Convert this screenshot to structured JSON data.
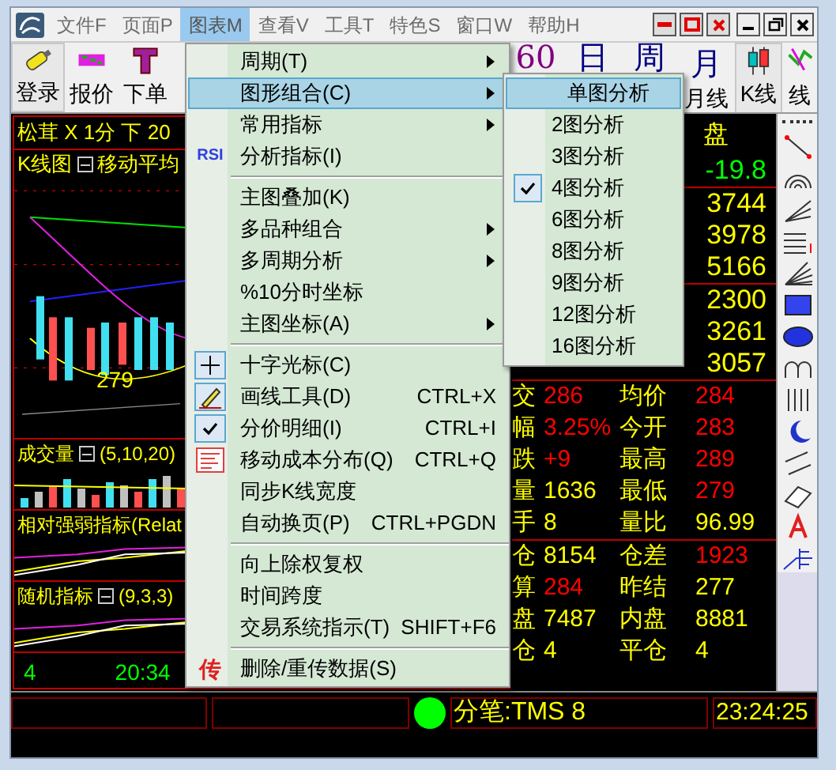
{
  "menu_bar": [
    {
      "label": "文件F",
      "selected": false
    },
    {
      "label": "页面P",
      "selected": false
    },
    {
      "label": "图表M",
      "selected": true
    },
    {
      "label": "查看V",
      "selected": false
    },
    {
      "label": "工具T",
      "selected": false
    },
    {
      "label": "特色S",
      "selected": false
    },
    {
      "label": "窗口W",
      "selected": false
    },
    {
      "label": "帮助H",
      "selected": false
    }
  ],
  "toolbar_left": [
    {
      "label": "登录"
    },
    {
      "label": "报价"
    },
    {
      "label": "下单"
    }
  ],
  "toolbar_right": [
    {
      "glyph": "60",
      "color": "#800080"
    },
    {
      "glyph": "日",
      "color": "#000080"
    },
    {
      "glyph": "周",
      "color": "#000080"
    },
    {
      "glyph": "月",
      "label": "月线",
      "color": "#000080"
    },
    {
      "label": "K线",
      "selected": true
    },
    {
      "label": "线",
      "selected": false
    }
  ],
  "chart": {
    "title": "松茸 X 1分 下 20",
    "main_label": "K线图",
    "main_indicator": "移动平均",
    "low_label": "279",
    "panels": [
      {
        "name": "成交量",
        "params": "(5,10,20)"
      },
      {
        "name": "相对强弱指标(Relat"
      },
      {
        "name": "随机指标",
        "params": "(9,3,3)"
      }
    ],
    "time_axis": [
      "4",
      "20:34"
    ]
  },
  "quote": {
    "header": "盘",
    "groups": [
      [
        {
          "text": "-19.8",
          "color": "#00ff00"
        }
      ],
      [
        {
          "text": "3744",
          "color": "#ffff00"
        },
        {
          "text": "3978",
          "color": "#ffff00"
        },
        {
          "text": "5166",
          "color": "#ffff00"
        }
      ],
      [
        {
          "text": "2300",
          "color": "#ffff00"
        },
        {
          "text": "3261",
          "color": "#ffff00"
        },
        {
          "text": "3057",
          "color": "#ffff00"
        }
      ]
    ],
    "tables": [
      [
        [
          {
            "text": "交",
            "color": "#ffff00"
          },
          {
            "text": "286",
            "color": "#ff0000"
          },
          {
            "text": "均价",
            "color": "#ffff00"
          },
          {
            "text": "284",
            "color": "#ff0000"
          }
        ],
        [
          {
            "text": "幅",
            "color": "#ffff00"
          },
          {
            "text": "3.25%",
            "color": "#ff0000"
          },
          {
            "text": "今开",
            "color": "#ffff00"
          },
          {
            "text": "283",
            "color": "#ff0000"
          }
        ],
        [
          {
            "text": "跌",
            "color": "#ffff00"
          },
          {
            "text": "+9",
            "color": "#ff0000"
          },
          {
            "text": "最高",
            "color": "#ffff00"
          },
          {
            "text": "289",
            "color": "#ff0000"
          }
        ],
        [
          {
            "text": "量",
            "color": "#ffff00"
          },
          {
            "text": "1636",
            "color": "#ffff00"
          },
          {
            "text": "最低",
            "color": "#ffff00"
          },
          {
            "text": "279",
            "color": "#ff0000"
          }
        ],
        [
          {
            "text": "手",
            "color": "#ffff00"
          },
          {
            "text": "8",
            "color": "#ffff00"
          },
          {
            "text": "量比",
            "color": "#ffff00"
          },
          {
            "text": "96.99",
            "color": "#ffff00"
          }
        ]
      ],
      [
        [
          {
            "text": "仓",
            "color": "#ffff00"
          },
          {
            "text": "8154",
            "color": "#ffff00"
          },
          {
            "text": "仓差",
            "color": "#ffff00"
          },
          {
            "text": "1923",
            "color": "#ff0000"
          }
        ],
        [
          {
            "text": "算",
            "color": "#ffff00"
          },
          {
            "text": "284",
            "color": "#ff0000"
          },
          {
            "text": "昨结",
            "color": "#ffff00"
          },
          {
            "text": "277",
            "color": "#ffff00"
          }
        ],
        [
          {
            "text": "盘",
            "color": "#ffff00"
          },
          {
            "text": "7487",
            "color": "#ffff00"
          },
          {
            "text": "内盘",
            "color": "#ffff00"
          },
          {
            "text": "8881",
            "color": "#ffff00"
          }
        ],
        [
          {
            "text": "仓",
            "color": "#ffff00"
          },
          {
            "text": "4",
            "color": "#ffff00"
          },
          {
            "text": "平仓",
            "color": "#ffff00"
          },
          {
            "text": "4",
            "color": "#ffff00"
          }
        ]
      ]
    ]
  },
  "dropdown": [
    {
      "kind": "item",
      "label": "周期(T)",
      "submenu": true,
      "selected": false
    },
    {
      "kind": "item",
      "label": "图形组合(C)",
      "submenu": true,
      "selected": true
    },
    {
      "kind": "item",
      "label": "常用指标",
      "submenu": true,
      "selected": false
    },
    {
      "kind": "item",
      "label": "分析指标(I)",
      "badge": "RSI",
      "selected": false
    },
    {
      "kind": "separator"
    },
    {
      "kind": "item",
      "label": "主图叠加(K)",
      "selected": false
    },
    {
      "kind": "item",
      "label": "多品种组合",
      "submenu": true,
      "selected": false
    },
    {
      "kind": "item",
      "label": "多周期分析",
      "submenu": true,
      "selected": false
    },
    {
      "kind": "item",
      "label": "%10分时坐标",
      "selected": false
    },
    {
      "kind": "item",
      "label": "主图坐标(A)",
      "submenu": true,
      "selected": false
    },
    {
      "kind": "separator"
    },
    {
      "kind": "item",
      "label": "十字光标(C)",
      "selected": false
    },
    {
      "kind": "item",
      "label": "画线工具(D)",
      "shortcut": "CTRL+X",
      "selected": false
    },
    {
      "kind": "item",
      "label": "分价明细(I)",
      "shortcut": "CTRL+I",
      "checked": true,
      "selected": false
    },
    {
      "kind": "item",
      "label": "移动成本分布(Q)",
      "shortcut": "CTRL+Q",
      "selected": false
    },
    {
      "kind": "item",
      "label": "同步K线宽度",
      "selected": false
    },
    {
      "kind": "item",
      "label": "自动换页(P)",
      "shortcut": "CTRL+PGDN",
      "selected": false
    },
    {
      "kind": "separator"
    },
    {
      "kind": "item",
      "label": "向上除权复权",
      "selected": false
    },
    {
      "kind": "item",
      "label": "时间跨度",
      "selected": false
    },
    {
      "kind": "item",
      "label": "交易系统指示(T)",
      "shortcut": "SHIFT+F6",
      "selected": false
    },
    {
      "kind": "separator"
    },
    {
      "kind": "item",
      "label": "删除/重传数据(S)",
      "badge": "传",
      "selected": false
    }
  ],
  "submenu": [
    {
      "label": "单图分析",
      "selected": true,
      "checked": false
    },
    {
      "label": "2图分析",
      "selected": false,
      "checked": false
    },
    {
      "label": "3图分析",
      "selected": false,
      "checked": false
    },
    {
      "label": "4图分析",
      "selected": false,
      "checked": true
    },
    {
      "label": "6图分析",
      "selected": false,
      "checked": false
    },
    {
      "label": "8图分析",
      "selected": false,
      "checked": false
    },
    {
      "label": "9图分析",
      "selected": false,
      "checked": false
    },
    {
      "label": "12图分析",
      "selected": false,
      "checked": false
    },
    {
      "label": "16图分析",
      "selected": false,
      "checked": false
    }
  ],
  "status_bar": {
    "connected": true,
    "message": "分笔:TMS 8",
    "time": "23:24:25"
  }
}
